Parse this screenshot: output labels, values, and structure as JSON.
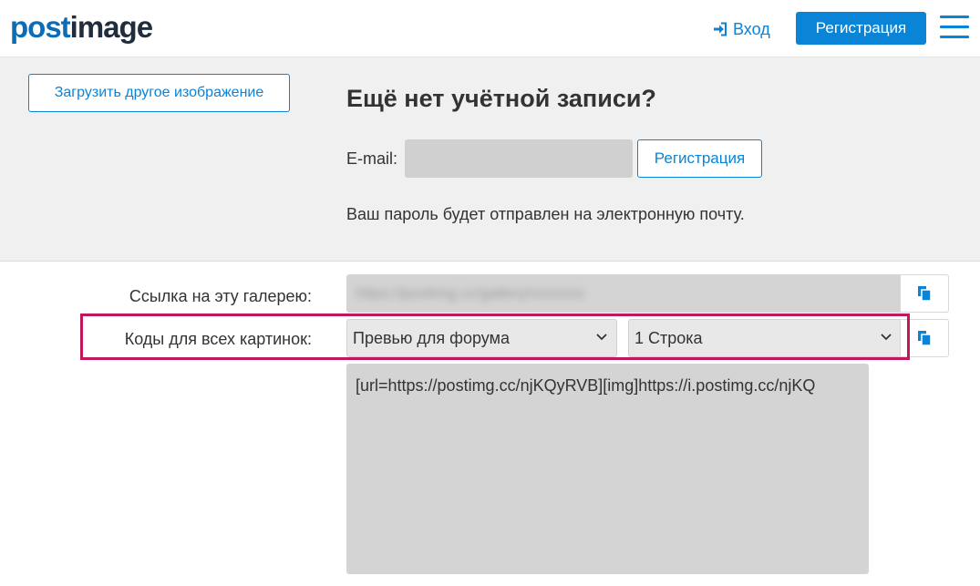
{
  "header": {
    "logo_post": "post",
    "logo_image": "image",
    "login_label": "Вход",
    "register_label": "Регистрация"
  },
  "account": {
    "upload_another_label": "Загрузить другое изображение",
    "title": "Ещё нет учётной записи?",
    "email_label": "E-mail:",
    "email_value": "",
    "register_label": "Регистрация",
    "password_note": "Ваш пароль будет отправлен на электронную почту."
  },
  "gallery": {
    "link_label": "Ссылка на эту галерею:",
    "link_value": "https://postimg.cc/gallery/xxxxxxx"
  },
  "codes": {
    "label": "Коды для всех картинок:",
    "format_selected": "Превью для форума",
    "layout_selected": "1 Строка",
    "code_text": "[url=https://postimg.cc/njKQyRVB][img]https://i.postimg.cc/njKQ"
  },
  "colors": {
    "accent": "#0a84d6",
    "highlight": "#c2185b"
  },
  "icons": {
    "login": "sign-in-icon",
    "menu": "hamburger-menu-icon",
    "copy": "copy-icon",
    "dropdown": "chevron-down-icon"
  }
}
